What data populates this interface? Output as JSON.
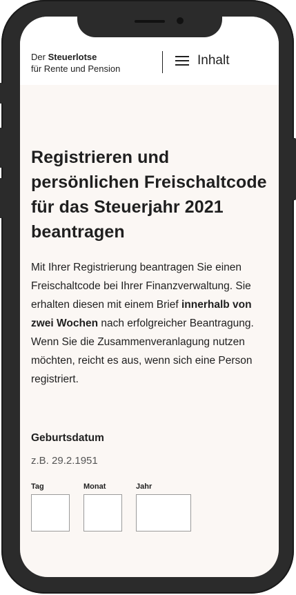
{
  "header": {
    "brand_prefix": "Der",
    "brand_name": "Steuerlotse",
    "brand_line2": "für Rente und Pension",
    "menu_label": "Inhalt"
  },
  "main": {
    "title": "Registrieren und persönlichen Freischaltcode für das Steuerjahr 2021 beantragen",
    "intro_part1": "Mit Ihrer Registrierung beantragen Sie einen Freischaltcode bei Ihrer Finanzverwaltung. Sie erhalten diesen mit einem Brief",
    "intro_bold": "innerhalb von zwei Wochen",
    "intro_part2": "nach erfolgreicher Beantragung. Wenn Sie die Zusammenveranlagung nutzen möchten, reicht es aus, wenn sich eine Person registriert."
  },
  "form": {
    "birthdate_label": "Geburtsdatum",
    "birthdate_hint": "z.B. 29.2.1951",
    "day_label": "Tag",
    "month_label": "Monat",
    "year_label": "Jahr",
    "day_value": "",
    "month_value": "",
    "year_value": ""
  },
  "icons": {
    "menu": "hamburger-icon"
  }
}
